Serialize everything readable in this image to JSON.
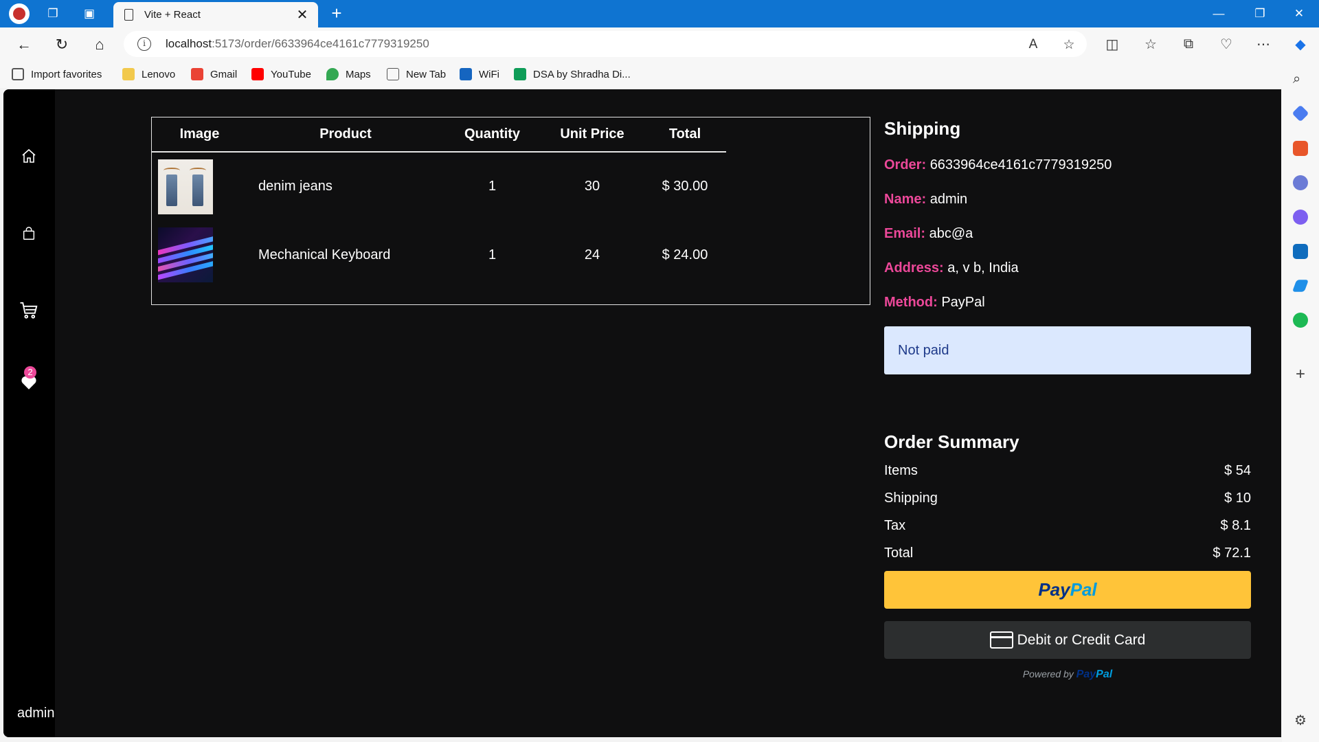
{
  "browser": {
    "tab_title": "Vite + React",
    "url_host": "localhost",
    "url_rest": ":5173/order/6633964ce4161c7779319250",
    "favorites": [
      {
        "label": "Import favorites",
        "icon": "import-icon",
        "color": "#555555"
      },
      {
        "label": "Lenovo",
        "icon": "folder-icon",
        "color": "#f2c94c"
      },
      {
        "label": "Gmail",
        "icon": "gmail-icon",
        "color": "#ea4335"
      },
      {
        "label": "YouTube",
        "icon": "youtube-icon",
        "color": "#ff0000"
      },
      {
        "label": "Maps",
        "icon": "maps-icon",
        "color": "#34a853"
      },
      {
        "label": "New Tab",
        "icon": "page-icon",
        "color": "#666666"
      },
      {
        "label": "WiFi",
        "icon": "wifi-s-icon",
        "color": "#1565c0"
      },
      {
        "label": "DSA by Shradha Di...",
        "icon": "sheets-icon",
        "color": "#0f9d58"
      }
    ]
  },
  "nav": {
    "wishlist_count": "2",
    "username": "admin"
  },
  "table": {
    "headers": [
      "Image",
      "Product",
      "Quantity",
      "Unit Price",
      "Total"
    ],
    "rows": [
      {
        "product": "denim jeans",
        "quantity": "1",
        "unit_price": "30",
        "total": "$ 30.00"
      },
      {
        "product": "Mechanical Keyboard",
        "quantity": "1",
        "unit_price": "24",
        "total": "$ 24.00"
      }
    ]
  },
  "shipping": {
    "heading": "Shipping",
    "order_label": "Order:",
    "order_id": "6633964ce4161c7779319250",
    "name_label": "Name:",
    "name": "admin",
    "email_label": "Email:",
    "email": "abc@a",
    "address_label": "Address:",
    "address": "a, v b, India",
    "method_label": "Method:",
    "method": "PayPal",
    "status": "Not paid"
  },
  "summary": {
    "heading": "Order Summary",
    "rows": [
      {
        "label": "Items",
        "value": "$ 54"
      },
      {
        "label": "Shipping",
        "value": "$ 10"
      },
      {
        "label": "Tax",
        "value": "$ 8.1"
      },
      {
        "label": "Total",
        "value": "$ 72.1"
      }
    ]
  },
  "payment": {
    "paypal_part1": "Pay",
    "paypal_part2": "Pal",
    "card_label": "Debit or Credit Card",
    "powered_by": "Powered by",
    "powered_brand1": "Pay",
    "powered_brand2": "Pal"
  },
  "colors": {
    "accent": "#ec4899",
    "page_bg": "#0f0f10",
    "paypal_yellow": "#ffc439",
    "status_bg": "#dbe8fe"
  }
}
